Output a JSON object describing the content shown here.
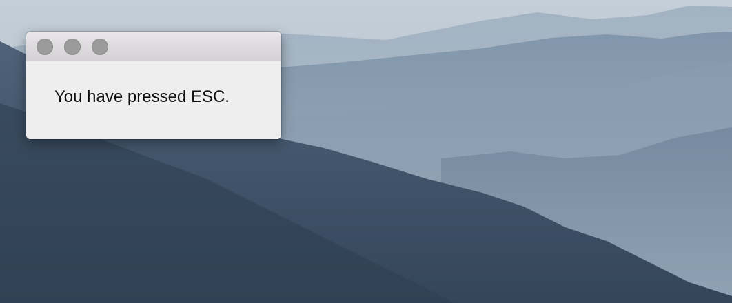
{
  "window": {
    "message": "You have pressed ESC."
  },
  "colors": {
    "window_background": "#efeeef",
    "titlebar": "#dcdadc",
    "traffic_light_inactive": "#9b9b9b"
  }
}
